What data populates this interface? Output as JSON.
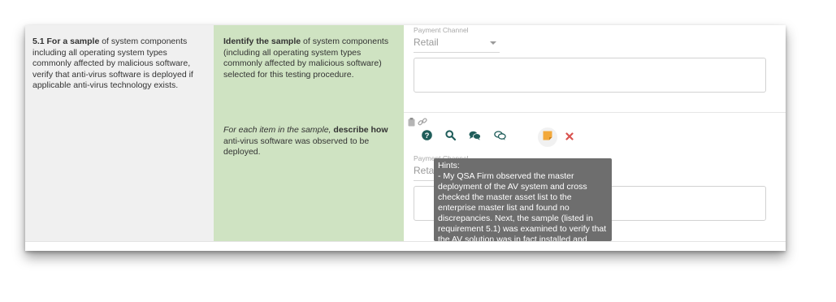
{
  "requirement": {
    "bold": "5.1 For a sample",
    "rest": " of system components including all operating system types commonly affected by malicious software, verify that anti-virus software is deployed if applicable anti-virus technology exists."
  },
  "testing": {
    "procedure_1": {
      "bold": "Identify the sample",
      "rest": " of system components (including all operating system types commonly affected by malicious software) selected for this testing procedure."
    },
    "procedure_2": {
      "italic": "For each item in the sample,",
      "bold": " describe how",
      "rest": " anti-virus software was observed to be deployed."
    }
  },
  "response_1": {
    "label": "Payment Channel",
    "select_value": "Retail"
  },
  "response_2": {
    "label": "Payment Channel",
    "select_value": "Retail"
  },
  "toolbar": {
    "icons": [
      "help-icon",
      "search-icon",
      "comments-icon",
      "comment-outline-icon",
      "sticky-note-icon",
      "close-icon"
    ],
    "colors": {
      "teal": "#1f5d5a",
      "orange": "#f2a83a",
      "red": "#d9534f"
    }
  },
  "tooltip": {
    "title": "Hints:",
    "body": "- My QSA Firm observed the master deployment of the AV system and cross checked the master asset list to the enterprise master list and found no discrepancies. Next, the sample (listed in requirement 5.1) was examined to verify that the AV solution was in fact installed and running."
  }
}
